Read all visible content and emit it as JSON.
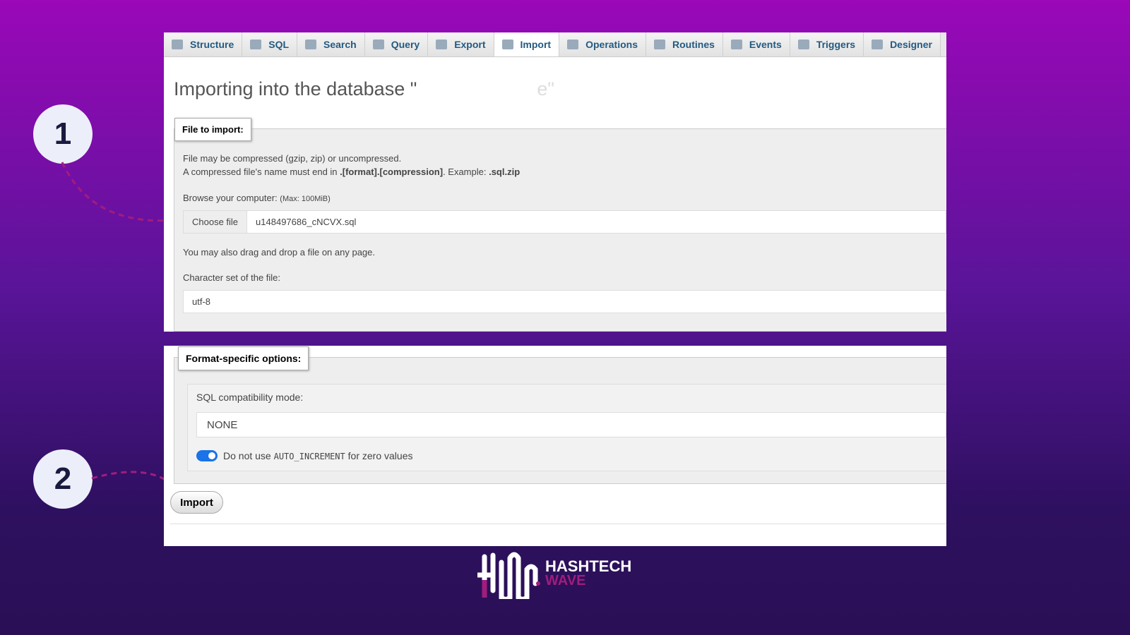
{
  "tabs": [
    {
      "label": "Structure",
      "icon": "structure-icon"
    },
    {
      "label": "SQL",
      "icon": "sql-icon"
    },
    {
      "label": "Search",
      "icon": "search-icon"
    },
    {
      "label": "Query",
      "icon": "query-icon"
    },
    {
      "label": "Export",
      "icon": "export-icon"
    },
    {
      "label": "Import",
      "icon": "import-icon",
      "active": true
    },
    {
      "label": "Operations",
      "icon": "wrench-icon"
    },
    {
      "label": "Routines",
      "icon": "routines-icon"
    },
    {
      "label": "Events",
      "icon": "clock-icon"
    },
    {
      "label": "Triggers",
      "icon": "triggers-icon"
    },
    {
      "label": "Designer",
      "icon": "designer-icon"
    }
  ],
  "title_prefix": "Importing into the database \"",
  "title_suffix": "e\"",
  "file": {
    "legend": "File to import:",
    "line1": "File may be compressed (gzip, zip) or uncompressed.",
    "line2a": "A compressed file's name must end in ",
    "line2b": ".[format].[compression]",
    "line2c": ". Example: ",
    "line2d": ".sql.zip",
    "browse": "Browse your computer: ",
    "max": "(Max: 100MiB)",
    "choose": "Choose file",
    "filename": "u148497686_cNCVX.sql",
    "drag": "You may also drag and drop a file on any page.",
    "charset_label": "Character set of the file:",
    "charset": "utf-8"
  },
  "format": {
    "legend": "Format-specific options:",
    "compat_label": "SQL compatibility mode:",
    "compat": "NONE",
    "toggle_a": "Do not use ",
    "toggle_code": "AUTO_INCREMENT",
    "toggle_b": " for zero values",
    "toggle_on": true
  },
  "import_button": "Import",
  "steps": [
    "1",
    "2"
  ],
  "logo": {
    "line1": "HASHTECH",
    "line2": "WAVE"
  },
  "colors": {
    "accent": "#9b1a7a",
    "toggle": "#1a73e8"
  }
}
